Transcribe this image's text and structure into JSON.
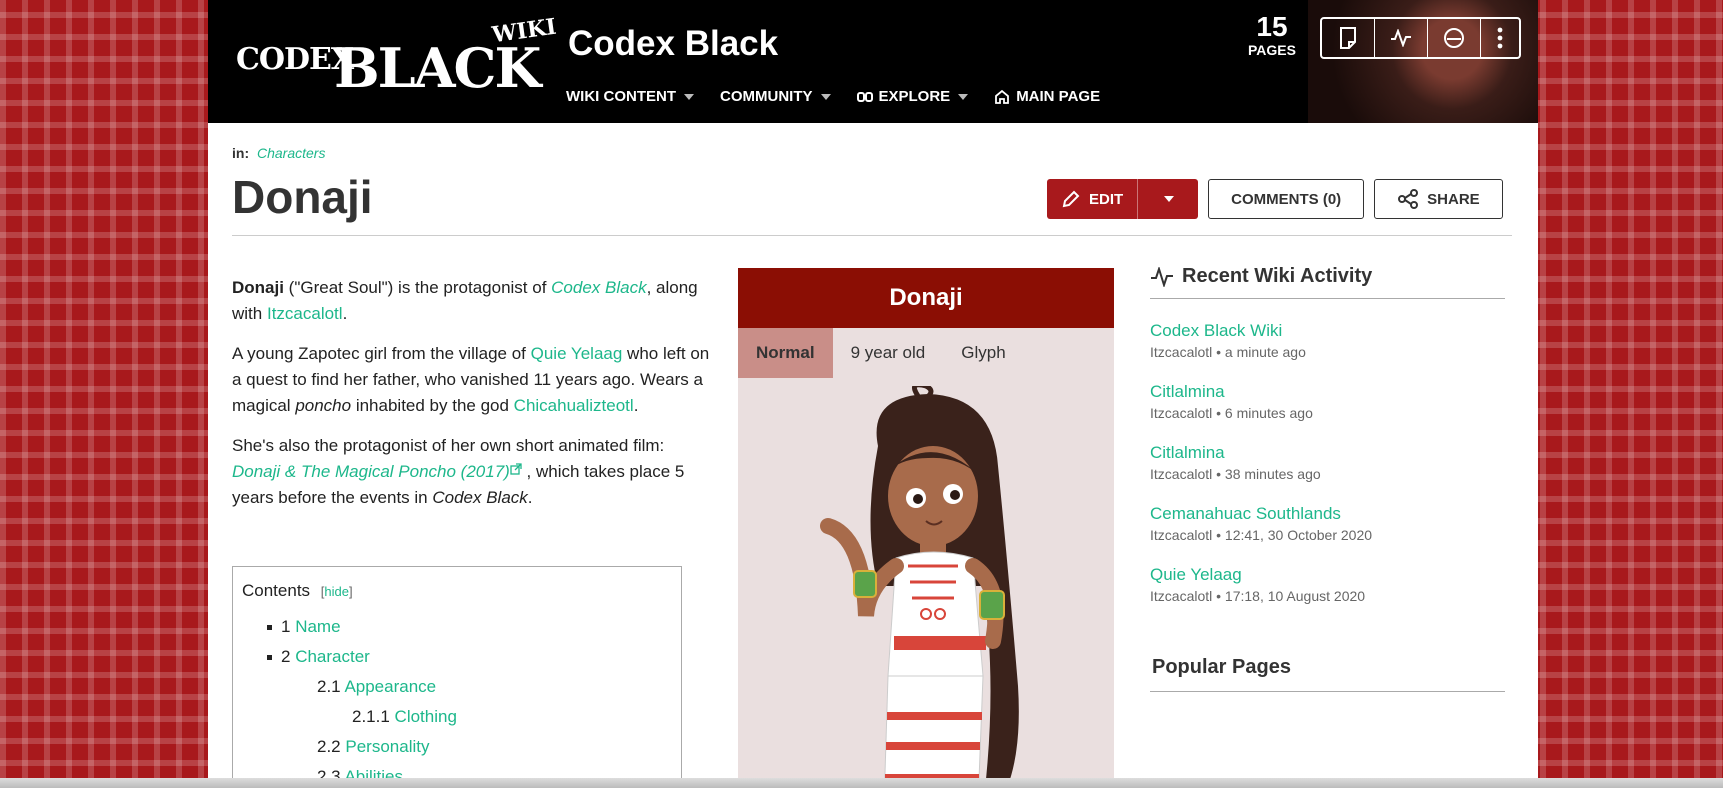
{
  "header": {
    "logo": {
      "codex": "CODEX",
      "black": "BLACK",
      "wiki": "WIKI"
    },
    "site_title": "Codex Black",
    "nav": [
      {
        "label": "WIKI CONTENT"
      },
      {
        "label": "COMMUNITY"
      },
      {
        "label": "EXPLORE"
      },
      {
        "label": "MAIN PAGE"
      }
    ],
    "pages": {
      "count": "15",
      "label": "PAGES"
    },
    "tools": [
      "page-icon",
      "activity-icon",
      "discussions-icon",
      "more-icon"
    ]
  },
  "breadcrumb": {
    "prefix": "in:",
    "category": "Characters"
  },
  "page_title": "Donaji",
  "actions": {
    "edit": "EDIT",
    "comments": "COMMENTS (0)",
    "share": "SHARE"
  },
  "article": {
    "p1": {
      "b": "Donaji",
      "t1": " (\"Great Soul\") is the protagonist of ",
      "link1": "Codex Black",
      "t2": ", along with ",
      "link2": "Itzcacalotl",
      "t3": "."
    },
    "p2": {
      "t1": "A young Zapotec girl from the village of ",
      "link1": "Quie Yelaag",
      "t2": " who left on a quest to find her father, who vanished 11 years ago. Wears a magical ",
      "i": "poncho",
      "t3": " inhabited by the god ",
      "link2": "Chicahualizteotl",
      "t4": "."
    },
    "p3": {
      "t1": "She's also the protagonist of her own short animated film: ",
      "link1": "Donaji & The Magical Poncho (2017)",
      "t2": " , which takes place 5 years before the events in ",
      "i": "Codex Black",
      "t3": "."
    }
  },
  "toc": {
    "title": "Contents",
    "hide": "hide",
    "items": [
      {
        "num": "1",
        "label": "Name"
      },
      {
        "num": "2",
        "label": "Character"
      },
      {
        "num": "2.1",
        "label": "Appearance"
      },
      {
        "num": "2.1.1",
        "label": "Clothing"
      },
      {
        "num": "2.2",
        "label": "Personality"
      },
      {
        "num": "2.3",
        "label": "Abilities"
      }
    ]
  },
  "infobox": {
    "title": "Donaji",
    "tabs": [
      "Normal",
      "9 year old",
      "Glyph"
    ],
    "active_tab": "Normal"
  },
  "sidebar": {
    "recent_title": "Recent Wiki Activity",
    "recent": [
      {
        "title": "Codex Black Wiki",
        "meta": "Itzcacalotl • a minute ago"
      },
      {
        "title": "Citlalmina",
        "meta": "Itzcacalotl • 6 minutes ago"
      },
      {
        "title": "Citlalmina",
        "meta": "Itzcacalotl • 38 minutes ago"
      },
      {
        "title": "Cemanahuac Southlands",
        "meta": "Itzcacalotl • 12:41, 30 October 2020"
      },
      {
        "title": "Quie Yelaag",
        "meta": "Itzcacalotl • 17:18, 10 August 2020"
      }
    ],
    "popular_title": "Popular Pages"
  },
  "colors": {
    "accent": "#1db78b",
    "brand_red": "#a8191c",
    "infobox_title": "#8b0e04",
    "infobox_tab_active": "#c98e88"
  }
}
